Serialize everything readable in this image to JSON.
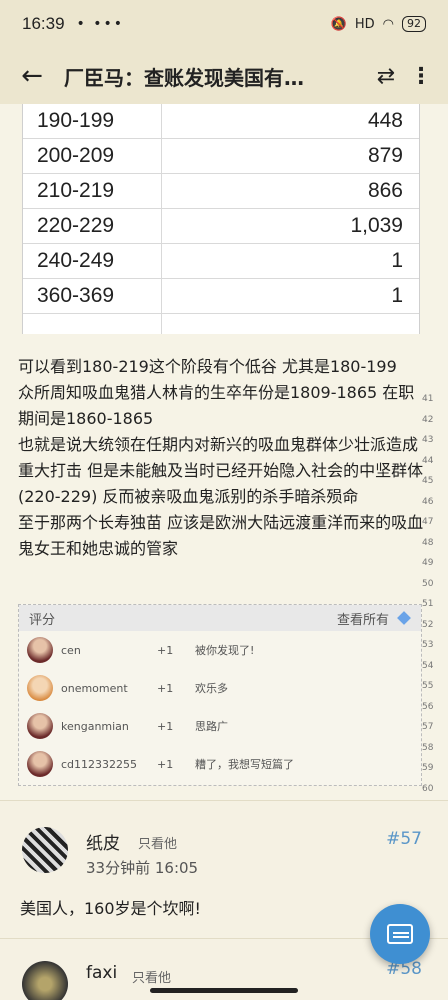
{
  "status": {
    "time": "16:39",
    "dots": "•  •••",
    "signal": "HD",
    "battery": "92"
  },
  "appbar": {
    "title": "厂臣马：查账发现美国有…",
    "swap_icon": "swap-icon",
    "more_icon": "more-icon"
  },
  "table": {
    "rows": [
      {
        "range": "190-199",
        "count": "448"
      },
      {
        "range": "200-209",
        "count": "879"
      },
      {
        "range": "210-219",
        "count": "866"
      },
      {
        "range": "220-229",
        "count": "1,039"
      },
      {
        "range": "240-249",
        "count": "1"
      },
      {
        "range": "360-369",
        "count": "1"
      }
    ]
  },
  "body": {
    "paragraphs": [
      "可以看到180-219这个阶段有个低谷  尤其是180-199",
      "众所周知吸血鬼猎人林肯的生卒年份是1809-1865  在职期间是1860-1865",
      "也就是说大统领在任期内对新兴的吸血鬼群体少壮派造成重大打击  但是未能触及当时已经开始隐入社会的中坚群体(220-229)  反而被亲吸血鬼派别的杀手暗杀殒命",
      "至于那两个长寿独苗  应该是欧洲大陆远渡重洋而来的吸血鬼女王和她忠诚的管家"
    ],
    "line_numbers": [
      "41",
      "42",
      "43",
      "44",
      "45",
      "46",
      "47",
      "48",
      "49",
      "50",
      "51",
      "52",
      "53",
      "54",
      "55",
      "56",
      "57",
      "58",
      "59",
      "60",
      "61",
      "62",
      "63"
    ]
  },
  "rating": {
    "header": "评分",
    "view_all": "查看所有",
    "items": [
      {
        "user": "cen",
        "points": "+1",
        "comment": "被你发现了!"
      },
      {
        "user": "onemoment",
        "points": "+1",
        "comment": "欢乐多"
      },
      {
        "user": "kenganmian",
        "points": "+1",
        "comment": "思路广"
      },
      {
        "user": "cd112332255",
        "points": "+1",
        "comment": "糟了，我想写短篇了"
      }
    ]
  },
  "comment57": {
    "name": "纸皮",
    "only_him": "只看他",
    "floor": "#57",
    "time": "33分钟前 16:05",
    "text": "美国人，160岁是个坎啊!"
  },
  "comment58": {
    "name": "faxi",
    "only_him": "只看他",
    "floor": "#58"
  },
  "colors": {
    "accent": "#3f8fd2",
    "floor_link": "#5a96c8",
    "background": "#f5f1e3"
  }
}
